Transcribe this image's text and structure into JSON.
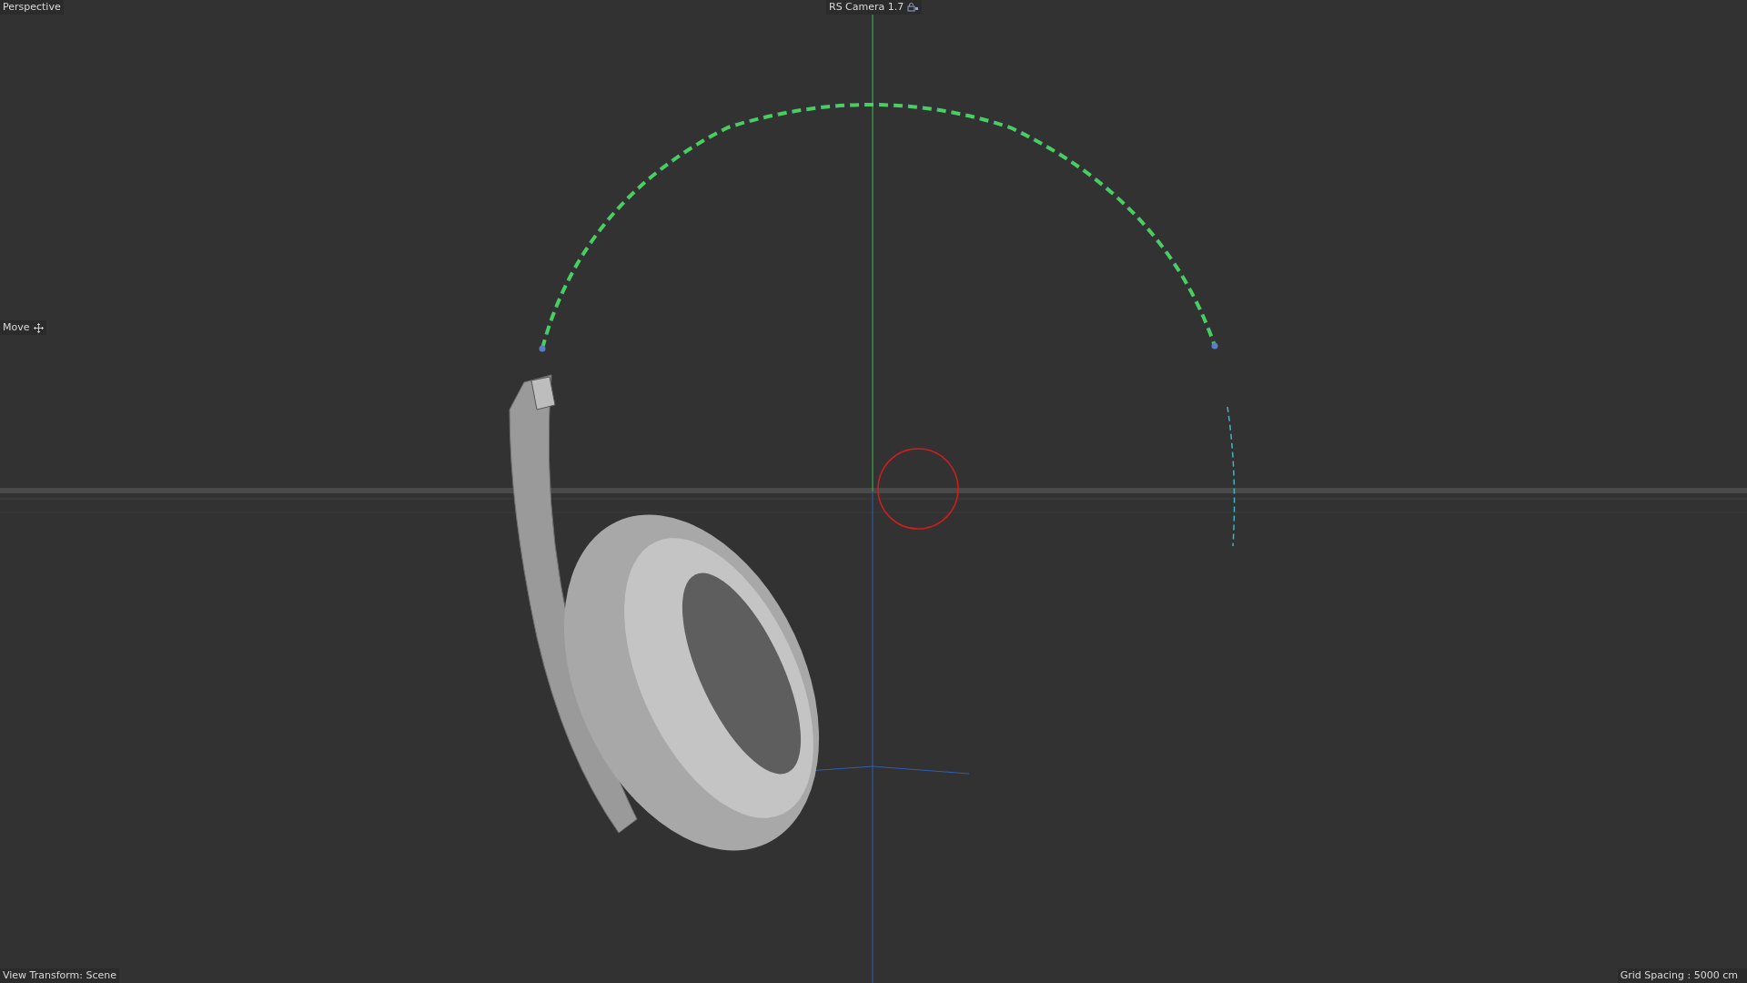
{
  "viewport": {
    "view_name": "Perspective",
    "camera_name": "RS Camera 1.7",
    "tool": "Move",
    "view_transform": "View Transform: Scene",
    "grid_spacing": "Grid Spacing : 5000 cm"
  }
}
